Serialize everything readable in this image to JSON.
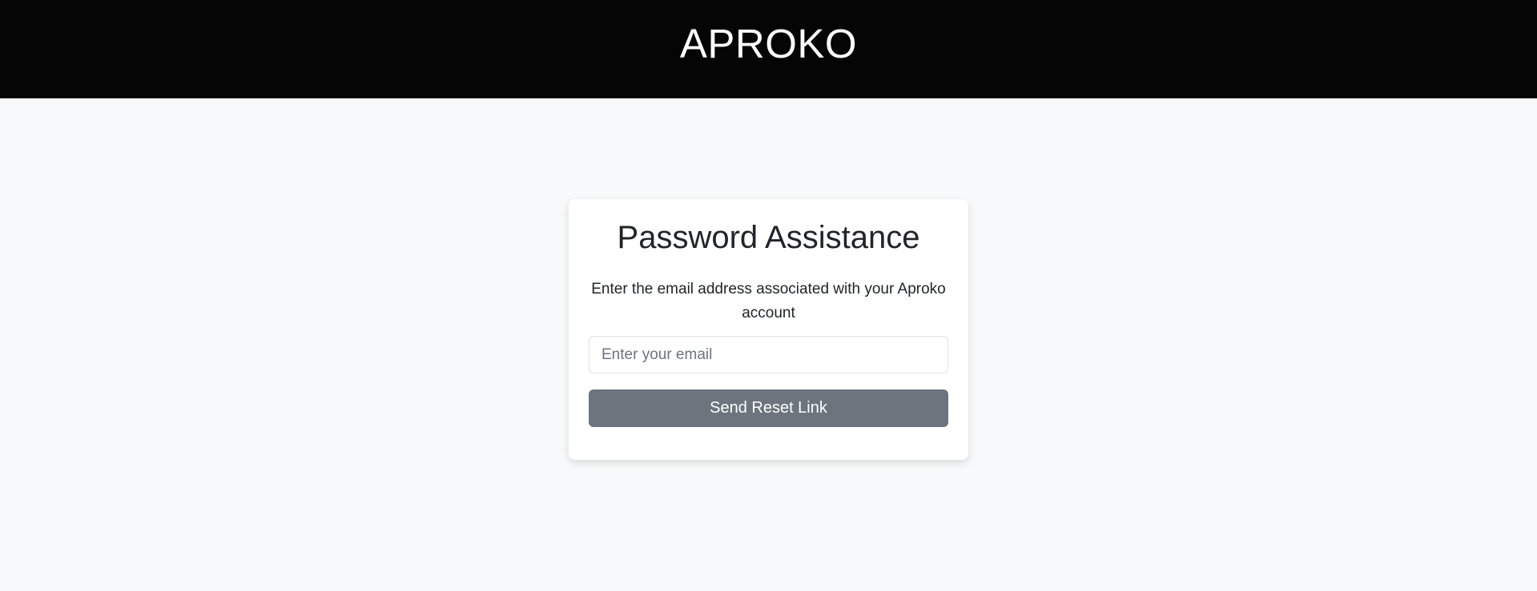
{
  "header": {
    "brand": "APROKO"
  },
  "reset_card": {
    "title": "Password Assistance",
    "description": "Enter the email address associated with your Aproko account",
    "email_placeholder": "Enter your email",
    "email_value": "",
    "submit_label": "Send Reset Link"
  },
  "colors": {
    "header_bg": "#050505",
    "page_bg": "#f8f9fa",
    "button_bg": "#6c757d"
  }
}
